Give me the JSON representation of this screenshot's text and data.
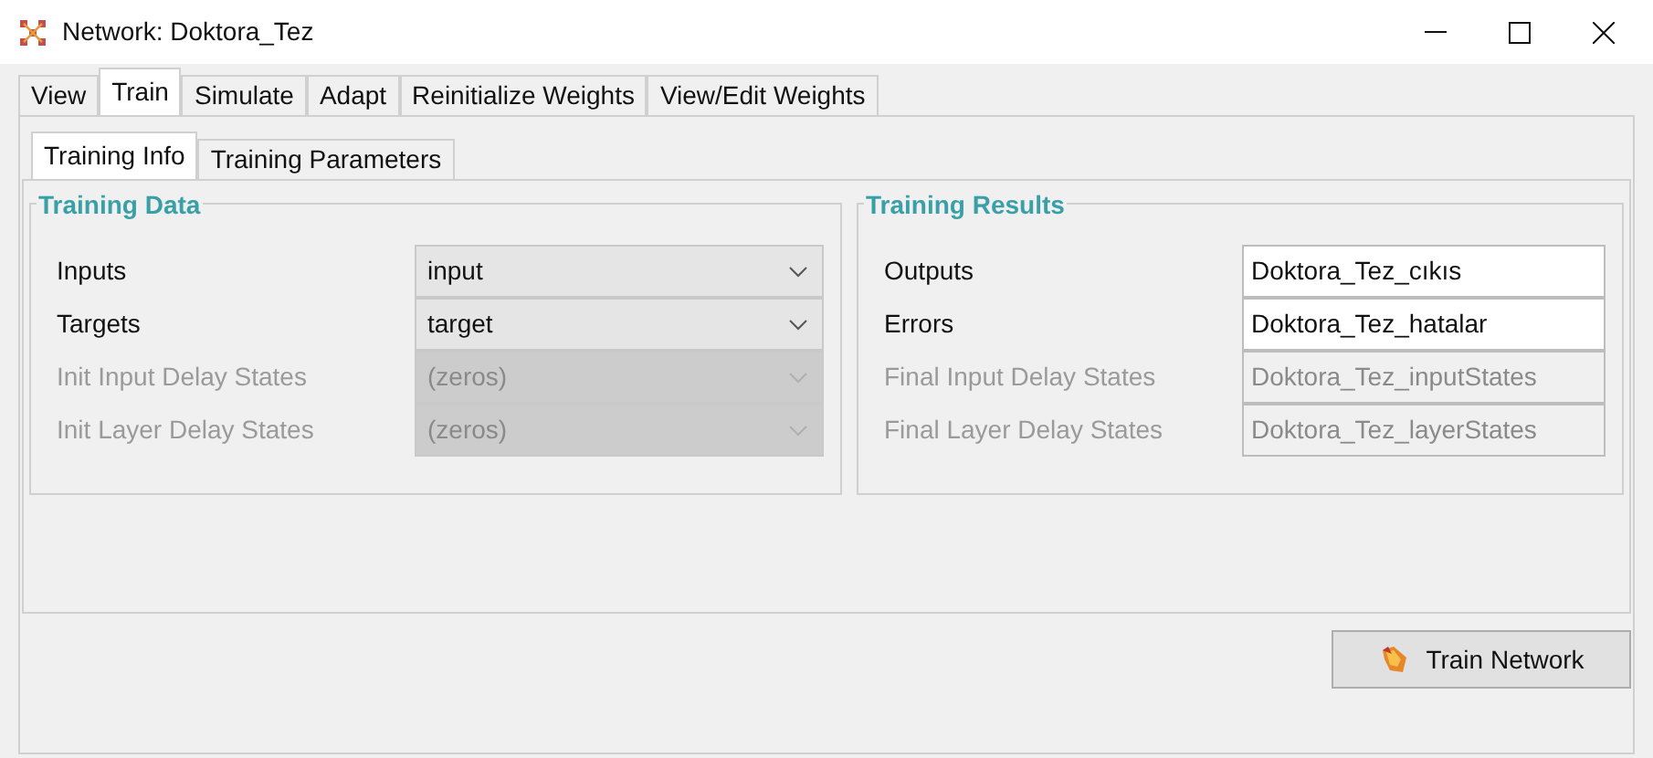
{
  "window": {
    "title": "Network: Doktora_Tez"
  },
  "tabs": [
    {
      "label": "View",
      "selected": false
    },
    {
      "label": "Train",
      "selected": true
    },
    {
      "label": "Simulate",
      "selected": false
    },
    {
      "label": "Adapt",
      "selected": false
    },
    {
      "label": "Reinitialize Weights",
      "selected": false
    },
    {
      "label": "View/Edit Weights",
      "selected": false
    }
  ],
  "subtabs": [
    {
      "label": "Training Info",
      "selected": true
    },
    {
      "label": "Training Parameters",
      "selected": false
    }
  ],
  "training_data": {
    "title": "Training Data",
    "rows": [
      {
        "label": "Inputs",
        "value": "input",
        "disabled": false
      },
      {
        "label": "Targets",
        "value": "target",
        "disabled": false
      },
      {
        "label": "Init Input Delay States",
        "value": "(zeros)",
        "disabled": true
      },
      {
        "label": "Init Layer Delay States",
        "value": "(zeros)",
        "disabled": true
      }
    ]
  },
  "training_results": {
    "title": "Training Results",
    "rows": [
      {
        "label": "Outputs",
        "value": "Doktora_Tez_cıkıs",
        "disabled": false
      },
      {
        "label": "Errors",
        "value": "Doktora_Tez_hatalar",
        "disabled": false
      },
      {
        "label": "Final Input Delay States",
        "value": "Doktora_Tez_inputStates",
        "disabled": true
      },
      {
        "label": "Final Layer Delay States",
        "value": "Doktora_Tez_layerStates",
        "disabled": true
      }
    ]
  },
  "train_button": {
    "label": "Train Network"
  }
}
